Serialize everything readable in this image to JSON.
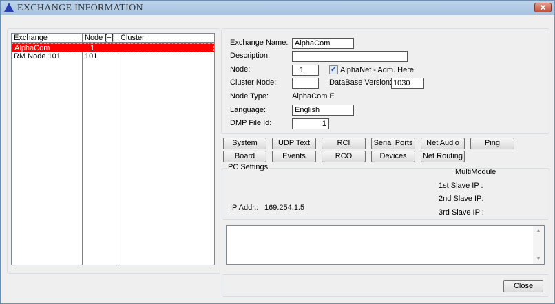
{
  "window": {
    "title": "EXCHANGE INFORMATION",
    "close_label": "✕"
  },
  "list": {
    "columns": [
      "Exchange",
      "Node [+]",
      "Cluster"
    ],
    "rows": [
      {
        "exchange": "AlphaCom",
        "node": "1",
        "cluster": ""
      },
      {
        "exchange": "RM Node 101",
        "node": "101",
        "cluster": ""
      }
    ]
  },
  "form": {
    "exchange_name_label": "Exchange Name:",
    "exchange_name": "AlphaCom",
    "description_label": "Description:",
    "description": "",
    "node_label": "Node:",
    "node": "1",
    "alphanet_label": "AlphaNet - Adm. Here",
    "alphanet_checked": true,
    "check_glyph": "✓",
    "cluster_node_label": "Cluster Node:",
    "cluster_node": "",
    "db_version_label": "DataBase Version:",
    "db_version": "1030",
    "node_type_label": "Node Type:",
    "node_type": "AlphaCom E",
    "language_label": "Language:",
    "language": "English",
    "dmp_label": "DMP File Id:",
    "dmp": "1"
  },
  "buttons": {
    "system": "System",
    "udp": "UDP Text",
    "rci": "RCI",
    "serial": "Serial Ports",
    "netaudio": "Net Audio",
    "ping": "Ping",
    "board": "Board",
    "events": "Events",
    "rco": "RCO",
    "devices": "Devices",
    "netrouting": "Net Routing",
    "close": "Close"
  },
  "pc": {
    "title": "PC Settings",
    "ip_label": "IP Addr.:",
    "ip": "169.254.1.5",
    "multimodule": "MultiModule",
    "slave1": "1st  Slave IP :",
    "slave2": "2nd Slave IP:",
    "slave3": "3rd Slave IP :"
  },
  "scroll": {
    "up": "▲",
    "down": "▼"
  }
}
